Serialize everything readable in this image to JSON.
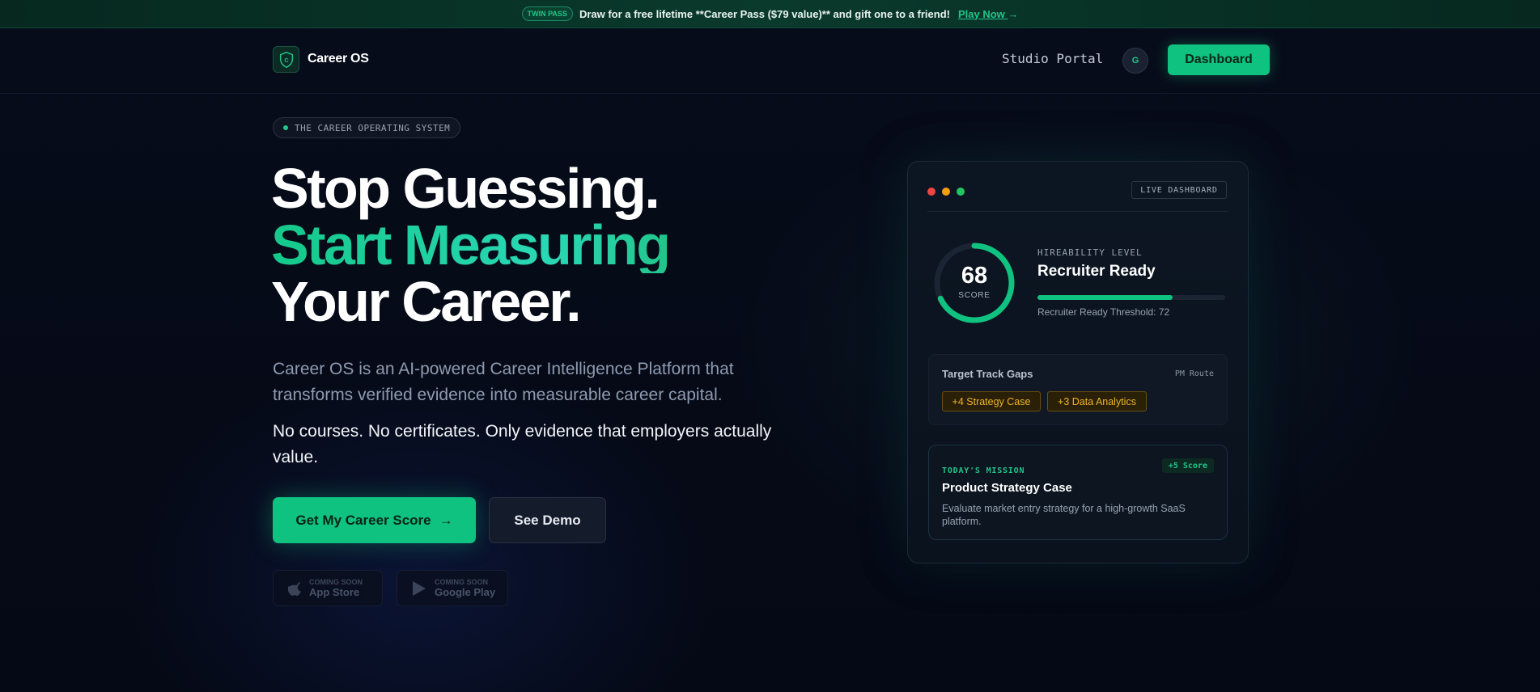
{
  "promo": {
    "badge": "TWIN PASS",
    "text": "Draw for a free lifetime **Career Pass ($79 value)** and gift one to a friend!",
    "link": "Play Now",
    "link_arrow": "→"
  },
  "header": {
    "logo_letter": "C",
    "brand": "Career OS",
    "studio": "Studio Portal",
    "avatar": "G",
    "dashboard": "Dashboard"
  },
  "hero": {
    "pill": "THE CAREER OPERATING SYSTEM",
    "line1": "Stop Guessing.",
    "line2": "Start Measuring",
    "line3": "Your Career.",
    "sub": "Career OS is an AI-powered Career Intelligence Platform that transforms verified evidence into measurable career capital.",
    "sub2": "No courses. No certificates. Only evidence that employers actually value.",
    "cta_primary": "Get My Career Score",
    "cta_arrow": "→",
    "cta_secondary": "See Demo",
    "stores": [
      {
        "small": "COMING SOON",
        "big": "App Store"
      },
      {
        "small": "COMING SOON",
        "big": "Google Play"
      }
    ]
  },
  "card": {
    "live": "LIVE DASHBOARD",
    "score": "68",
    "score_label": "SCORE",
    "score_fraction": 0.68,
    "hire_label": "HIREABILITY LEVEL",
    "hire_value": "Recruiter Ready",
    "threshold": "Recruiter Ready Threshold: 72",
    "gaps_title": "Target Track Gaps",
    "gaps_route": "PM Route",
    "chips": [
      "+4 Strategy Case",
      "+3 Data Analytics"
    ],
    "mission_tag": "TODAY'S MISSION",
    "mission_plus": "+5 Score",
    "mission_title": "Product Strategy Case",
    "mission_desc": "Evaluate market entry strategy for a high-growth SaaS platform."
  },
  "colors": {
    "accent": "#10c27f",
    "background": "#060a17",
    "chip_text": "#f0b429",
    "traffic": [
      "#ef4444",
      "#f59e0b",
      "#22c55e"
    ]
  }
}
